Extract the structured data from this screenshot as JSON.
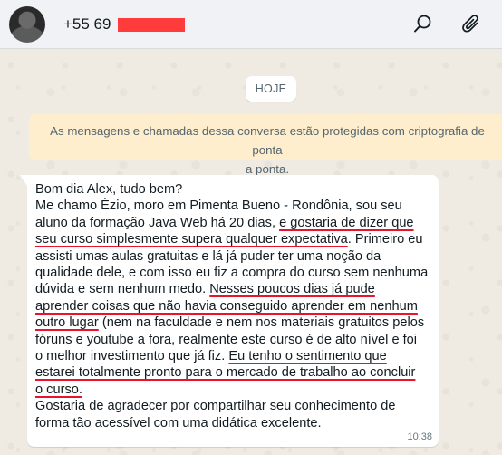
{
  "header": {
    "contact_number": "+55 69",
    "avatar_icon": "avatar-photo",
    "search_icon": "search-icon",
    "attach_icon": "paperclip-icon"
  },
  "chat": {
    "date_label": "HOJE",
    "encryption_notice": [
      "As mensagens e chamadas dessa conversa estão protegidas com criptografia de ponta",
      "a ponta."
    ],
    "message": {
      "lines": [
        [
          {
            "t": "Bom dia Alex, tudo bem?",
            "u": false
          }
        ],
        [
          {
            "t": "Me chamo Ézio, moro em Pimenta Bueno - Rondônia, sou seu",
            "u": false
          }
        ],
        [
          {
            "t": "aluno da formação Java Web há 20 dias, ",
            "u": false
          },
          {
            "t": "e gostaria de dizer que",
            "u": true
          }
        ],
        [
          {
            "t": "seu curso simplesmente supera qualquer expectativa",
            "u": true
          },
          {
            "t": ". Primeiro eu",
            "u": false
          }
        ],
        [
          {
            "t": "assisti umas aulas gratuitas e lá já puder ter uma noção da",
            "u": false
          }
        ],
        [
          {
            "t": "qualidade dele, e com isso eu fiz a compra do curso sem nenhuma",
            "u": false
          }
        ],
        [
          {
            "t": "dúvida e sem nenhum medo. ",
            "u": false
          },
          {
            "t": "Nesses poucos dias já pude",
            "u": true
          }
        ],
        [
          {
            "t": "aprender coisas que não havia conseguido aprender em nenhum",
            "u": true
          }
        ],
        [
          {
            "t": "outro lugar",
            "u": true
          },
          {
            "t": " (nem na faculdade e nem nos materiais gratuitos pelos",
            "u": false
          }
        ],
        [
          {
            "t": "fóruns e youtube a fora, realmente este curso é de alto nível e foi",
            "u": false
          }
        ],
        [
          {
            "t": "o melhor investimento que já fiz. ",
            "u": false
          },
          {
            "t": "Eu tenho o sentimento que",
            "u": true
          }
        ],
        [
          {
            "t": "estarei totalmente pronto para o mercado de trabalho ao concluir",
            "u": true
          }
        ],
        [
          {
            "t": "o curso.",
            "u": true
          }
        ],
        [
          {
            "t": "Gostaria de agradecer por compartilhar seu conhecimento de",
            "u": false
          }
        ],
        [
          {
            "t": "forma tão acessível com uma didática excelente.",
            "u": false
          }
        ]
      ],
      "time": "10:38"
    }
  },
  "colors": {
    "header_bg": "#f0f2f5",
    "chat_bg": "#efeae2",
    "notice_bg": "#ffeecd",
    "underline": "#e8142e",
    "redaction": "#ff3b3b"
  }
}
